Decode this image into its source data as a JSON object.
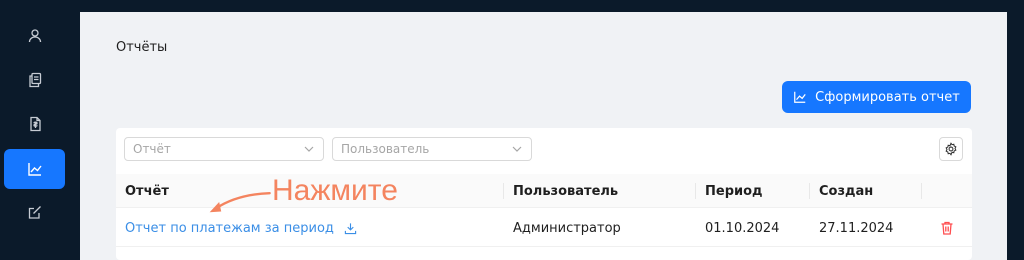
{
  "sidebar": {
    "items": [
      {
        "icon": "user-icon",
        "active": false
      },
      {
        "icon": "documents-icon",
        "active": false
      },
      {
        "icon": "invoice-icon",
        "active": false
      },
      {
        "icon": "chart-icon",
        "active": true
      },
      {
        "icon": "edit-icon",
        "active": false
      }
    ]
  },
  "page": {
    "title": "Отчёты",
    "generate_button_label": "Сформировать отчет"
  },
  "filters": {
    "report_placeholder": "Отчёт",
    "user_placeholder": "Пользователь"
  },
  "table": {
    "headers": [
      "Отчёт",
      "Пользователь",
      "Период",
      "Создан"
    ],
    "rows": [
      {
        "report": "Отчет по платежам за период",
        "user": "Администратор",
        "period": "01.10.2024",
        "created": "27.11.2024"
      }
    ]
  },
  "annotation": {
    "text": "Нажмите",
    "color": "#f4845f"
  },
  "colors": {
    "accent": "#1677ff",
    "sidebar_bg": "#0b1a2a",
    "link": "#3a8ee6",
    "danger": "#ff4d4f"
  }
}
